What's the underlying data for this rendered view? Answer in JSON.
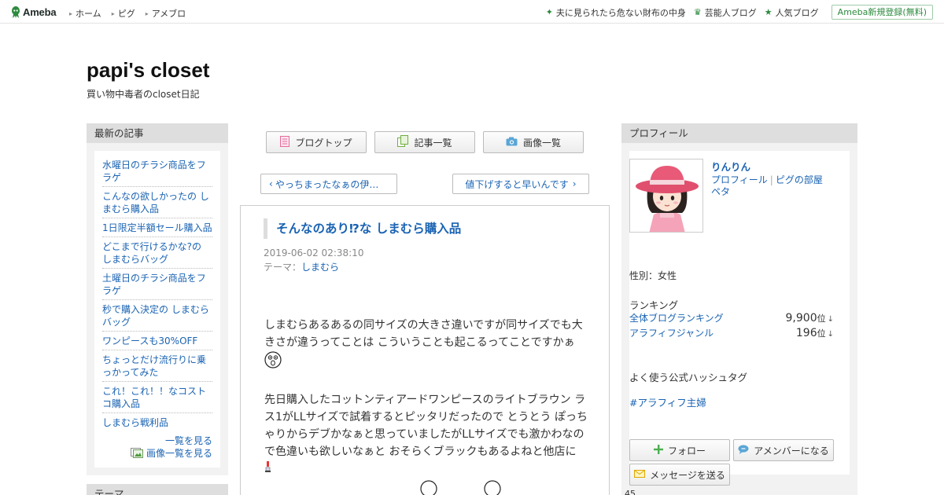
{
  "globalbar": {
    "logo": "Ameba",
    "nav": [
      "ホーム",
      "ピグ",
      "アメブロ"
    ],
    "links": [
      {
        "label": "夫に見られたら危ない財布の中身",
        "icon": "sparkle-icon"
      },
      {
        "label": "芸能人ブログ",
        "icon": "crown-icon"
      },
      {
        "label": "人気ブログ",
        "icon": "star-icon"
      }
    ],
    "register": "Ameba新規登録(無料)"
  },
  "blog": {
    "title": "papi's closet",
    "description": "買い物中毒者のcloset日記"
  },
  "left": {
    "recent_head": "最新の記事",
    "entries": [
      "水曜日のチラシ商品をフラゲ",
      "こんなの欲しかったの しまむら購入品",
      "1日限定半額セール購入品",
      "どこまで行けるかな?の しまむらバッグ",
      "土曜日のチラシ商品をフラゲ",
      "秒で購入決定の しまむらバッグ",
      "ワンピースも30%OFF",
      "ちょっとだけ流行りに乗っかってみた",
      "これ！これ！！なコストコ購入品",
      "しまむら戦利品"
    ],
    "more_list": "一覧を見る",
    "more_images": "画像一覧を見る",
    "theme_head": "テーマ"
  },
  "center": {
    "buttons": [
      "ブログトップ",
      "記事一覧",
      "画像一覧"
    ],
    "prev": "やっちまったなぁの伊…",
    "next": "値下げすると早いんです",
    "article": {
      "title": "そんなのあり⁉な しまむら購入品",
      "date": "2019-06-02 02:38:10",
      "theme_label": "テーマ：",
      "theme": "しまむら",
      "paragraph1": "しまむらあるあるの同サイズの大きさ違いですが同サイズでも大きさが違うってことは こういうことも起こるってことですかぁ",
      "paragraph2": "先日購入したコットンティアードワンピースのライトブラウン ラス1がLLサイズで試着するとピッタリだったので とうとう ぽっちゃりからデブかなぁと思っていましたがLLサイズでも激かわなので色違いも欲しいなぁと おそらくブラックもあるよねと他店に"
    }
  },
  "right": {
    "profile_head": "プロフィール",
    "nickname": "りんりん",
    "link_profile": "プロフィール",
    "link_pig": "ピグの部屋",
    "link_peta": "ペタ",
    "sex": "性別：女性",
    "ranking_head": "ランキング",
    "rankings": [
      {
        "label": "全体ブログランキング",
        "value": "9,900",
        "unit": "位",
        "arrow": "↓"
      },
      {
        "label": "アラフィフジャンル",
        "value": "196",
        "unit": "位",
        "arrow": "↓"
      }
    ],
    "hashtag_head": "よく使う公式ハッシュタグ",
    "hashtag": "#アラフィフ主婦",
    "follow": "フォロー",
    "amember": "アメンバーになる",
    "message": "メッセージを送る",
    "bottom_text": "45"
  },
  "colors": {
    "link": "#1a63b3",
    "brand_green": "#2d8a3e",
    "sidebar_head": "#dedede",
    "sidebar_bg": "#f2f2f2"
  }
}
